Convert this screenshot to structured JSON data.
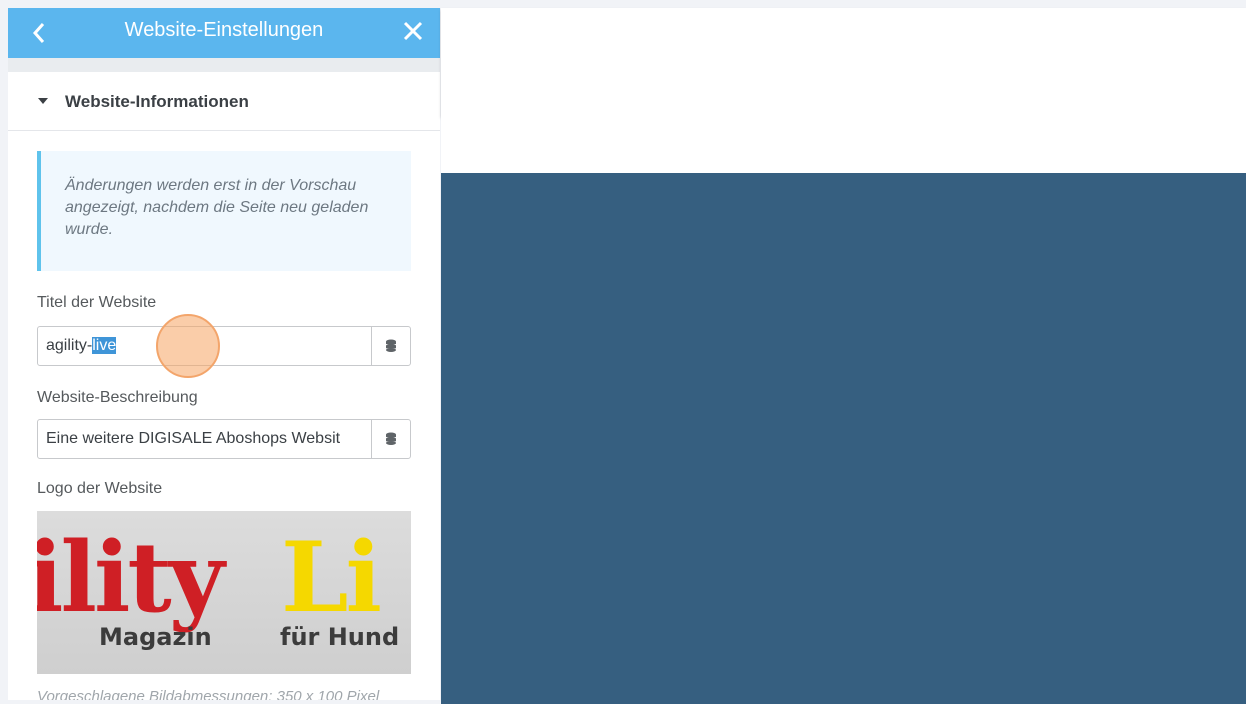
{
  "header": {
    "title": "Website-Einstellungen",
    "back_icon": "chevron-left-icon",
    "close_icon": "close-icon",
    "color": "#5bb6ee"
  },
  "section": {
    "title": "Website-Informationen"
  },
  "notice": {
    "text": "Änderungen werden erst in der Vorschau angezeigt, nachdem die Seite neu geladen wurde."
  },
  "fields": {
    "site_title": {
      "label": "Titel der Website",
      "value_prefix": "agility-",
      "value_selected": "live",
      "button_icon": "database-icon"
    },
    "site_description": {
      "label": "Website-Beschreibung",
      "value": "Eine weitere DIGISALE Aboshops Websit",
      "button_icon": "database-icon"
    },
    "logo": {
      "label": "Logo der Website",
      "image_text_red": "ility",
      "image_text_yellow": "Li",
      "image_sub_left": "Magazin",
      "image_sub_right": "für Hund"
    }
  },
  "hint": "Vorgeschlagene Bildabmessungen: 350 x 100 Pixel",
  "preview": {
    "hero_color": "#365f80"
  }
}
